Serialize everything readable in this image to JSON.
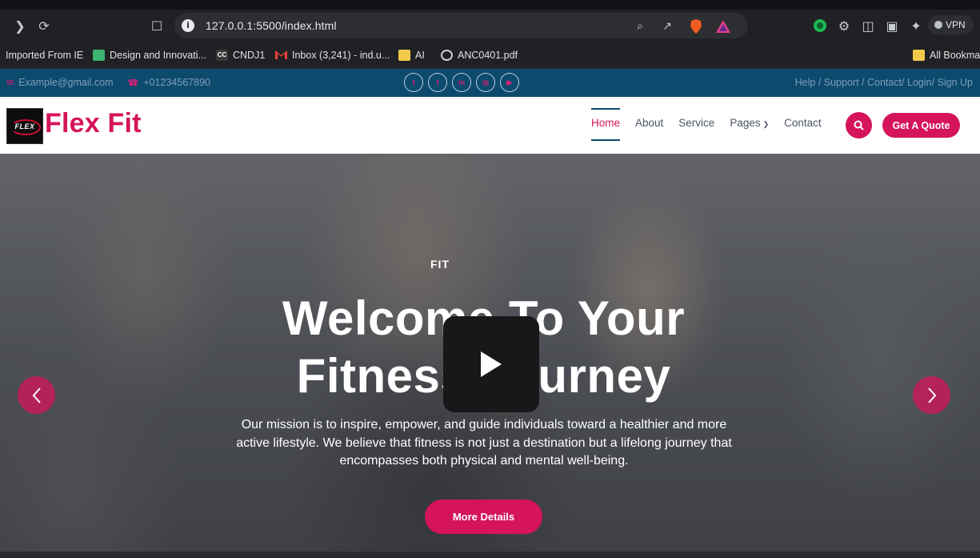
{
  "browser": {
    "url": "127.0.0.1:5500/index.html",
    "vpn_label": "VPN",
    "bookmarks": [
      {
        "label": "Imported From IE"
      },
      {
        "label": "Design and Innovati..."
      },
      {
        "label": "CNDJ1",
        "icon_text": "CC"
      },
      {
        "label": "Inbox (3,241) - ind.u..."
      },
      {
        "label": "AI"
      },
      {
        "label": "ANC0401.pdf"
      },
      {
        "label": "All Bookmar"
      }
    ]
  },
  "topbar": {
    "email": "Example@gmail.com",
    "phone": "+01234567890",
    "socials": [
      "twitter-icon",
      "facebook-icon",
      "linkedin-icon",
      "instagram-icon",
      "youtube-icon"
    ],
    "links": [
      "Help",
      "Support",
      "Contact",
      "Login",
      "Sign Up"
    ],
    "links_text": "Help  /  Support  /  Contact/  Login/  Sign Up"
  },
  "nav": {
    "logo_text": "FLEX",
    "brand": "Flex Fit",
    "items": [
      "Home",
      "About",
      "Service",
      "Pages",
      "Contact"
    ],
    "active": "Home",
    "quote_button": "Get A Quote"
  },
  "hero": {
    "tag": "FIT",
    "title_line1": "Welcome To Your",
    "title_line2": "Fitness Journey",
    "description": "Our mission is to inspire, empower, and guide individuals toward a healthier and more active lifestyle. We believe that fitness is not just a destination but a lifelong journey that encompasses both physical and mental well-being.",
    "button": "More Details"
  },
  "colors": {
    "accent": "#d5145a",
    "topbar": "#0c4a6e"
  }
}
